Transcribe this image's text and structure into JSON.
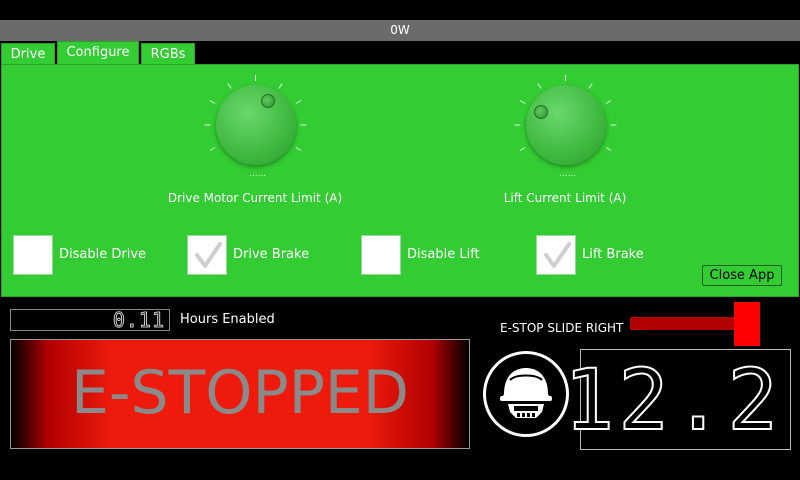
{
  "title_bar": {
    "text": "0W"
  },
  "tabs": [
    {
      "label": "Drive",
      "active": false
    },
    {
      "label": "Configure",
      "active": true
    },
    {
      "label": "RGBs",
      "active": false
    }
  ],
  "configure": {
    "knobs": [
      {
        "label": "Drive Motor Current Limit (A)",
        "dots": "......"
      },
      {
        "label": "Lift Current Limit (A)",
        "dots": "......"
      }
    ],
    "checkboxes": [
      {
        "label": "Disable Drive",
        "checked": false
      },
      {
        "label": "Drive Brake",
        "checked": true
      },
      {
        "label": "Disable Lift",
        "checked": false
      },
      {
        "label": "Lift Brake",
        "checked": true
      }
    ],
    "close_button": "Close App"
  },
  "hours": {
    "value": "0.11",
    "label": "Hours Enabled"
  },
  "estop": {
    "banner_text": "E-STOPPED",
    "slide_label": "E-STOP SLIDE RIGHT",
    "slider_level": 1.0
  },
  "battery": {
    "value": "12.2"
  },
  "colors": {
    "panel_green": "#33cc33",
    "estop_red": "#ee1b0c",
    "slider_track": "#b30000",
    "slider_thumb": "#ff0000"
  },
  "icons": {
    "logo": "helmet-logo-icon"
  }
}
